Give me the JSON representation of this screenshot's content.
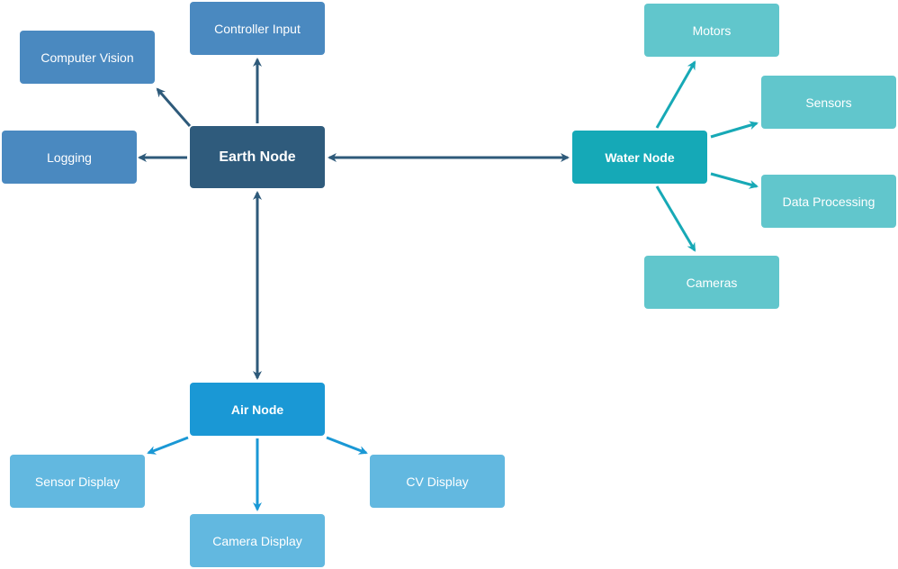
{
  "colors": {
    "earth": "#2f5b7c",
    "earth_child": "#4a89c0",
    "water": "#15a9b7",
    "water_child": "#61c6cc",
    "air": "#1a98d5",
    "air_child": "#62b8e0"
  },
  "nodes": {
    "earth": "Earth Node",
    "water": "Water Node",
    "air": "Air Node",
    "controller_input": "Controller Input",
    "computer_vision": "Computer Vision",
    "logging": "Logging",
    "motors": "Motors",
    "sensors": "Sensors",
    "data_processing": "Data Processing",
    "cameras": "Cameras",
    "sensor_display": "Sensor Display",
    "camera_display": "Camera Display",
    "cv_display": "CV Display"
  },
  "edges": [
    {
      "from": "Earth Node",
      "to": "Controller Input"
    },
    {
      "from": "Earth Node",
      "to": "Computer Vision"
    },
    {
      "from": "Earth Node",
      "to": "Logging"
    },
    {
      "from": "Earth Node",
      "to": "Water Node",
      "bidirectional": true
    },
    {
      "from": "Earth Node",
      "to": "Air Node",
      "bidirectional": true
    },
    {
      "from": "Water Node",
      "to": "Motors"
    },
    {
      "from": "Water Node",
      "to": "Sensors"
    },
    {
      "from": "Water Node",
      "to": "Data Processing"
    },
    {
      "from": "Water Node",
      "to": "Cameras"
    },
    {
      "from": "Air Node",
      "to": "Sensor Display"
    },
    {
      "from": "Air Node",
      "to": "Camera Display"
    },
    {
      "from": "Air Node",
      "to": "CV Display"
    }
  ]
}
